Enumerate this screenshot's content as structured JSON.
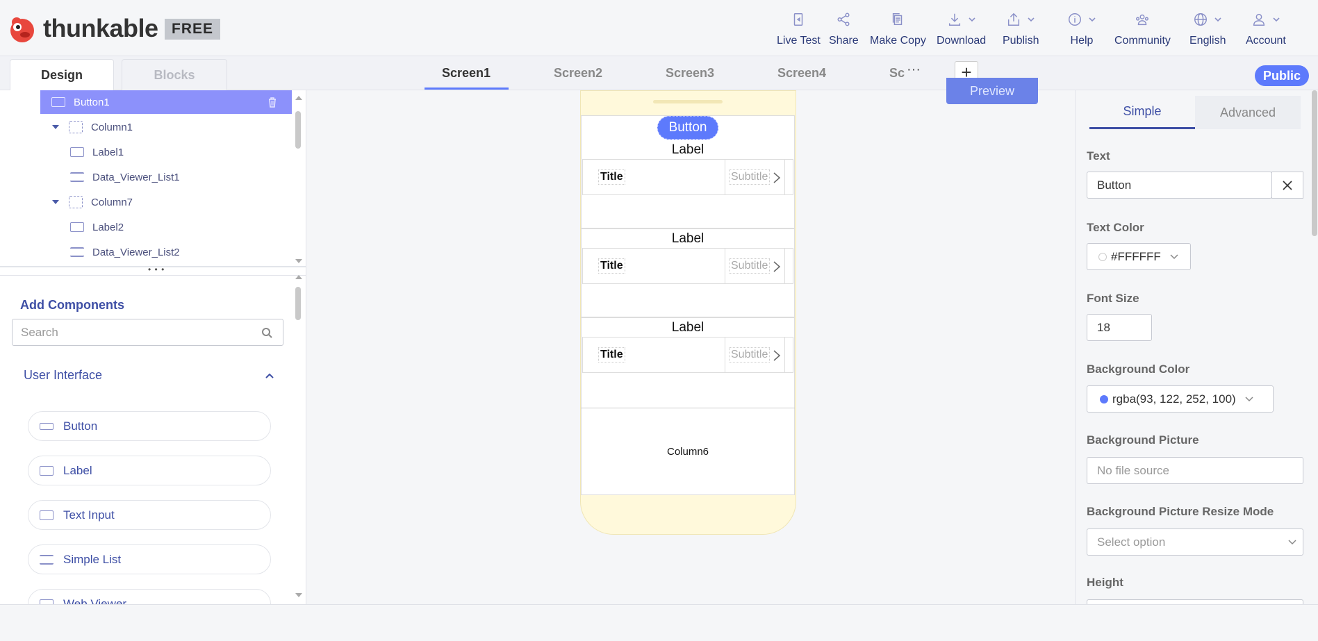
{
  "app": {
    "brand": "thunkable",
    "plan_badge": "FREE"
  },
  "topnav": [
    {
      "label": "Live Test",
      "icon": "phone-icon"
    },
    {
      "label": "Share",
      "icon": "share-icon"
    },
    {
      "label": "Make Copy",
      "icon": "copy-icon"
    },
    {
      "label": "Download",
      "icon": "download-icon"
    },
    {
      "label": "Publish",
      "icon": "publish-icon"
    },
    {
      "label": "Help",
      "icon": "info-icon"
    },
    {
      "label": "Community",
      "icon": "community-icon"
    },
    {
      "label": "English",
      "icon": "globe-icon"
    },
    {
      "label": "Account",
      "icon": "user-icon"
    }
  ],
  "mode_tabs": {
    "design": "Design",
    "blocks": "Blocks"
  },
  "screens": [
    "Screen1",
    "Screen2",
    "Screen3",
    "Screen4",
    "Sc"
  ],
  "more": "···",
  "add_screen": "+",
  "visibility_badge": "Public",
  "tree": [
    {
      "label": "Button1",
      "selected": true
    },
    {
      "label": "Column1"
    },
    {
      "label": "Label1"
    },
    {
      "label": "Data_Viewer_List1"
    },
    {
      "label": "Column7"
    },
    {
      "label": "Label2"
    },
    {
      "label": "Data_Viewer_List2"
    }
  ],
  "add_components": {
    "title": "Add Components",
    "search_placeholder": "Search",
    "section": "User Interface",
    "items": [
      "Button",
      "Label",
      "Text Input",
      "Simple List",
      "Web Viewer"
    ]
  },
  "phone": {
    "button": "Button",
    "labels": [
      "Label",
      "Label",
      "Label"
    ],
    "list_title": "Title",
    "list_subtitle": "Subtitle",
    "column6": "Column6"
  },
  "preview_label": "Preview",
  "properties": {
    "tabs": {
      "simple": "Simple",
      "advanced": "Advanced"
    },
    "text_label": "Text",
    "text_value": "Button",
    "text_color_label": "Text Color",
    "text_color_value": "#FFFFFF",
    "font_size_label": "Font Size",
    "font_size_value": "18",
    "bg_color_label": "Background Color",
    "bg_color_value": "rgba(93, 122, 252, 100)",
    "bg_picture_label": "Background Picture",
    "bg_picture_placeholder": "No file source",
    "resize_mode_label": "Background Picture Resize Mode",
    "resize_mode_placeholder": "Select option",
    "height_label": "Height"
  },
  "colors": {
    "accent": "#5d7afc",
    "selected_row": "#8c91fb",
    "phone_bg": "#fff9db"
  }
}
